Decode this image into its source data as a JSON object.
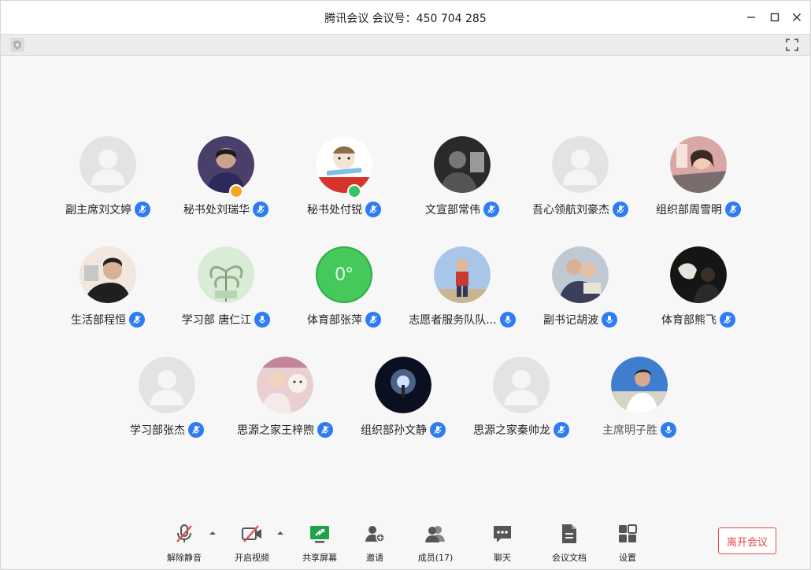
{
  "window": {
    "title": "腾讯会议 会议号：450 704 285"
  },
  "colors": {
    "accent": "#2d7cf6",
    "leave": "#e24b4b",
    "green_avatar": "#44c95a"
  },
  "participants": [
    {
      "name": "副主席刘文婷",
      "avatar": "default"
    },
    {
      "name": "秘书处刘瑞华",
      "avatar": "photo-dark-purple",
      "badge": "orange"
    },
    {
      "name": "秘书处付锐",
      "avatar": "cartoon"
    },
    {
      "name": "文宣部常伟",
      "avatar": "photo-grey"
    },
    {
      "name": "吾心领航刘豪杰",
      "avatar": "default"
    },
    {
      "name": "组织部周雪明",
      "avatar": "photo-pink"
    },
    {
      "name": "生活部程恒",
      "avatar": "photo-light"
    },
    {
      "name": "学习部 唐仁江",
      "avatar": "photo-green"
    },
    {
      "name": "体育部张萍",
      "avatar": "green-circle",
      "avatar_text": "0°"
    },
    {
      "name": "志愿者服务队队...",
      "avatar": "photo-sky"
    },
    {
      "name": "副书记胡波",
      "avatar": "photo-mixed"
    },
    {
      "name": "体育部熊飞",
      "avatar": "photo-black"
    },
    {
      "name": "学习部张杰",
      "avatar": "default"
    },
    {
      "name": "思源之家王梓煦",
      "avatar": "photo-rose"
    },
    {
      "name": "组织部孙文静",
      "avatar": "photo-night"
    },
    {
      "name": "思源之家秦帅龙",
      "avatar": "default"
    },
    {
      "name": "主席明子胜",
      "avatar": "photo-blue"
    }
  ],
  "bottom_bar": {
    "unmute": "解除静音",
    "start_video": "开启视频",
    "share_screen": "共享屏幕",
    "invite": "邀请",
    "members": "成员(17)",
    "chat": "聊天",
    "docs": "会议文档",
    "settings": "设置",
    "leave": "离开会议"
  }
}
